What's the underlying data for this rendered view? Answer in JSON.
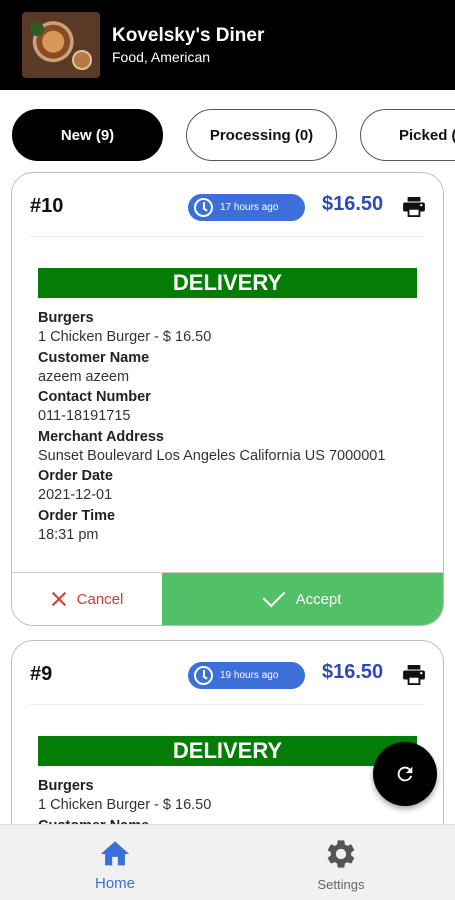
{
  "header": {
    "restaurant_name": "Kovelsky's Diner",
    "category": "Food, American"
  },
  "tabs": [
    {
      "label": "New (9)",
      "active": true
    },
    {
      "label": "Processing (0)",
      "active": false
    },
    {
      "label": "Picked (",
      "active": false
    }
  ],
  "orders": [
    {
      "number": "#10",
      "time_ago": "17 hours ago",
      "price": "$16.50",
      "type": "DELIVERY",
      "fields": {
        "category_label": "Burgers",
        "items": "1 Chicken Burger - $ 16.50",
        "customer_label": "Customer Name",
        "customer_name": "azeem azeem",
        "contact_label": "Contact Number",
        "contact_number": "011-18191715",
        "address_label": "Merchant Address",
        "address": "Sunset Boulevard Los Angeles California US 7000001",
        "date_label": "Order Date",
        "date": "2021-12-01",
        "time_label": "Order Time",
        "time": "18:31 pm"
      },
      "cancel_label": "Cancel",
      "accept_label": "Accept"
    },
    {
      "number": "#9",
      "time_ago": "19 hours ago",
      "price": "$16.50",
      "type": "DELIVERY",
      "fields": {
        "category_label": "Burgers",
        "items": "1 Chicken Burger - $ 16.50",
        "customer_label": "Customer Name"
      }
    }
  ],
  "bottom_nav": {
    "home_label": "Home",
    "settings_label": "Settings"
  },
  "colors": {
    "accent_blue": "#3d6fd8",
    "price_blue": "#2f4bb0",
    "delivery_green": "#037d06",
    "accept_green": "#52c067",
    "cancel_red": "#d03a3a"
  },
  "icons": [
    "clock-icon",
    "print-icon",
    "close-icon",
    "check-icon",
    "refresh-icon",
    "home-icon",
    "gear-icon"
  ]
}
